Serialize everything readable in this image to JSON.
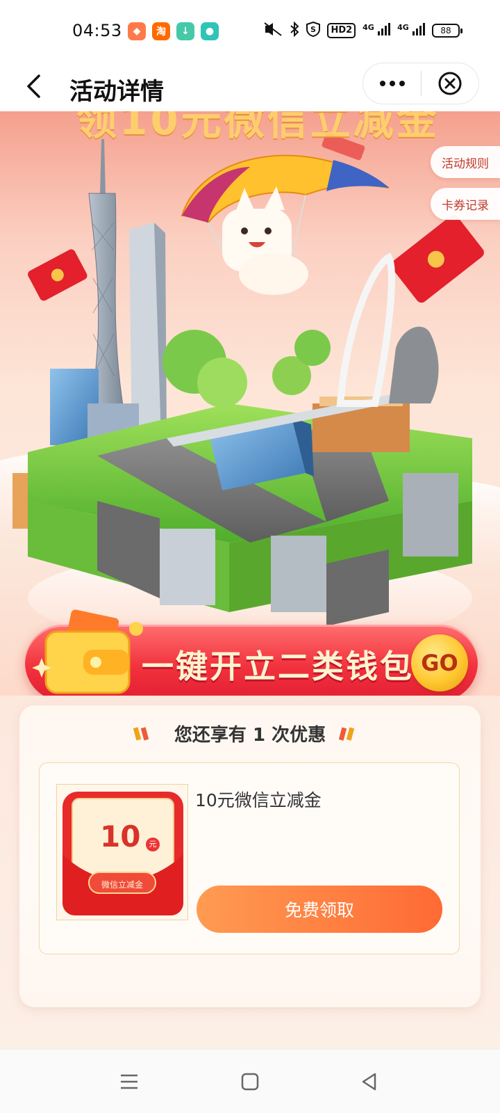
{
  "status_bar": {
    "time": "04:53",
    "app_icons": [
      {
        "name": "game-app-icon",
        "glyph": "◆",
        "color": "#ff6a3d"
      },
      {
        "name": "taobao-app-icon",
        "glyph": "淘",
        "color": "#ff5a00"
      },
      {
        "name": "download-app-icon",
        "glyph": "↓",
        "color": "#3cc9a4"
      },
      {
        "name": "chat-app-icon",
        "glyph": "●",
        "color": "#2ec4b6"
      }
    ],
    "hd_label": "HD2",
    "network_1": "4G",
    "network_2": "4G",
    "battery": "88"
  },
  "nav": {
    "title": "活动详情"
  },
  "hero": {
    "side_tabs": [
      "活动规则",
      "卡券记录"
    ],
    "wallet_banner_text": "一键开立二类钱包",
    "go_label": "GO"
  },
  "offer": {
    "header_prefix": "您还享有",
    "count": "1",
    "header_suffix": "次优惠",
    "coupon": {
      "amount": "10",
      "unit": "元",
      "ribbon_label": "微信立减金",
      "title": "10元微信立减金",
      "button_label": "免费领取"
    }
  },
  "colors": {
    "accent_orange": "#ff6a34",
    "banner_red": "#f2323d",
    "gold": "#ffc830"
  }
}
